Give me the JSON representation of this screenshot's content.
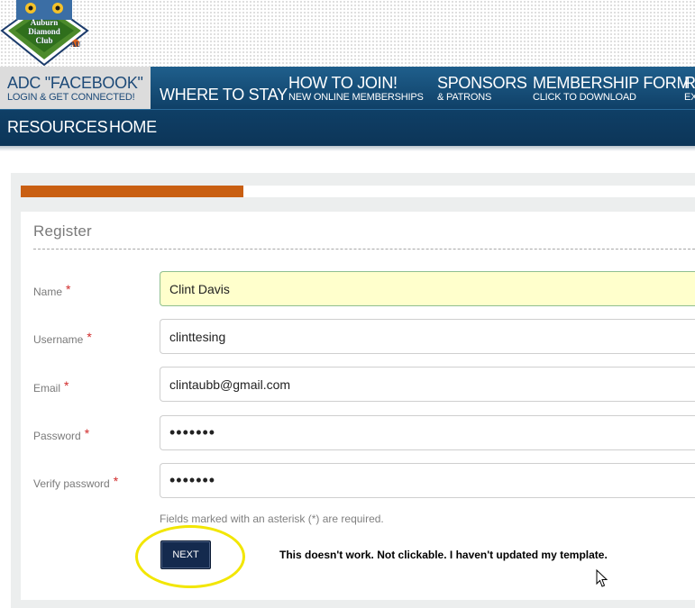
{
  "logo": {
    "text_lines": [
      "Auburn",
      "Diamond",
      "Club"
    ]
  },
  "nav": {
    "items": [
      {
        "main": "ADC \"FACEBOOK\"",
        "sub": "LOGIN & GET CONNECTED!"
      },
      {
        "main": "WHERE TO STAY",
        "sub": ""
      },
      {
        "main": "HOW TO JOIN!",
        "sub": "NEW ONLINE MEMBERSHIPS"
      },
      {
        "main": "SPONSORS",
        "sub": "& PATRONS"
      },
      {
        "main": "MEMBERSHIP FORM",
        "sub": "CLICK TO DOWNLOAD"
      },
      {
        "main": "RE",
        "sub": "EX"
      },
      {
        "main": "RESOURCES",
        "sub": ""
      },
      {
        "main": "HOME",
        "sub": ""
      }
    ]
  },
  "progress": {
    "fraction": 0.33
  },
  "form": {
    "legend": "Register",
    "fields": [
      {
        "label": "Name",
        "value": "Clint Davis"
      },
      {
        "label": "Username",
        "value": "clinttesing"
      },
      {
        "label": "Email",
        "value": "clintaubb@gmail.com"
      },
      {
        "label": "Password",
        "value": "•••••••"
      },
      {
        "label": "Verify password",
        "value": "•••••••"
      }
    ],
    "required_marker": "*",
    "required_note": "Fields marked with an asterisk (*) are required.",
    "next_label": "NEXT"
  },
  "annotation": {
    "text": "This doesn't work.  Not clickable.  I haven't updated my template."
  },
  "colors": {
    "nav": "#0f3f66",
    "progress": "#c95f12",
    "button": "#142a4e",
    "highlight": "#f2e600",
    "focus_field": "#ffffcc"
  }
}
